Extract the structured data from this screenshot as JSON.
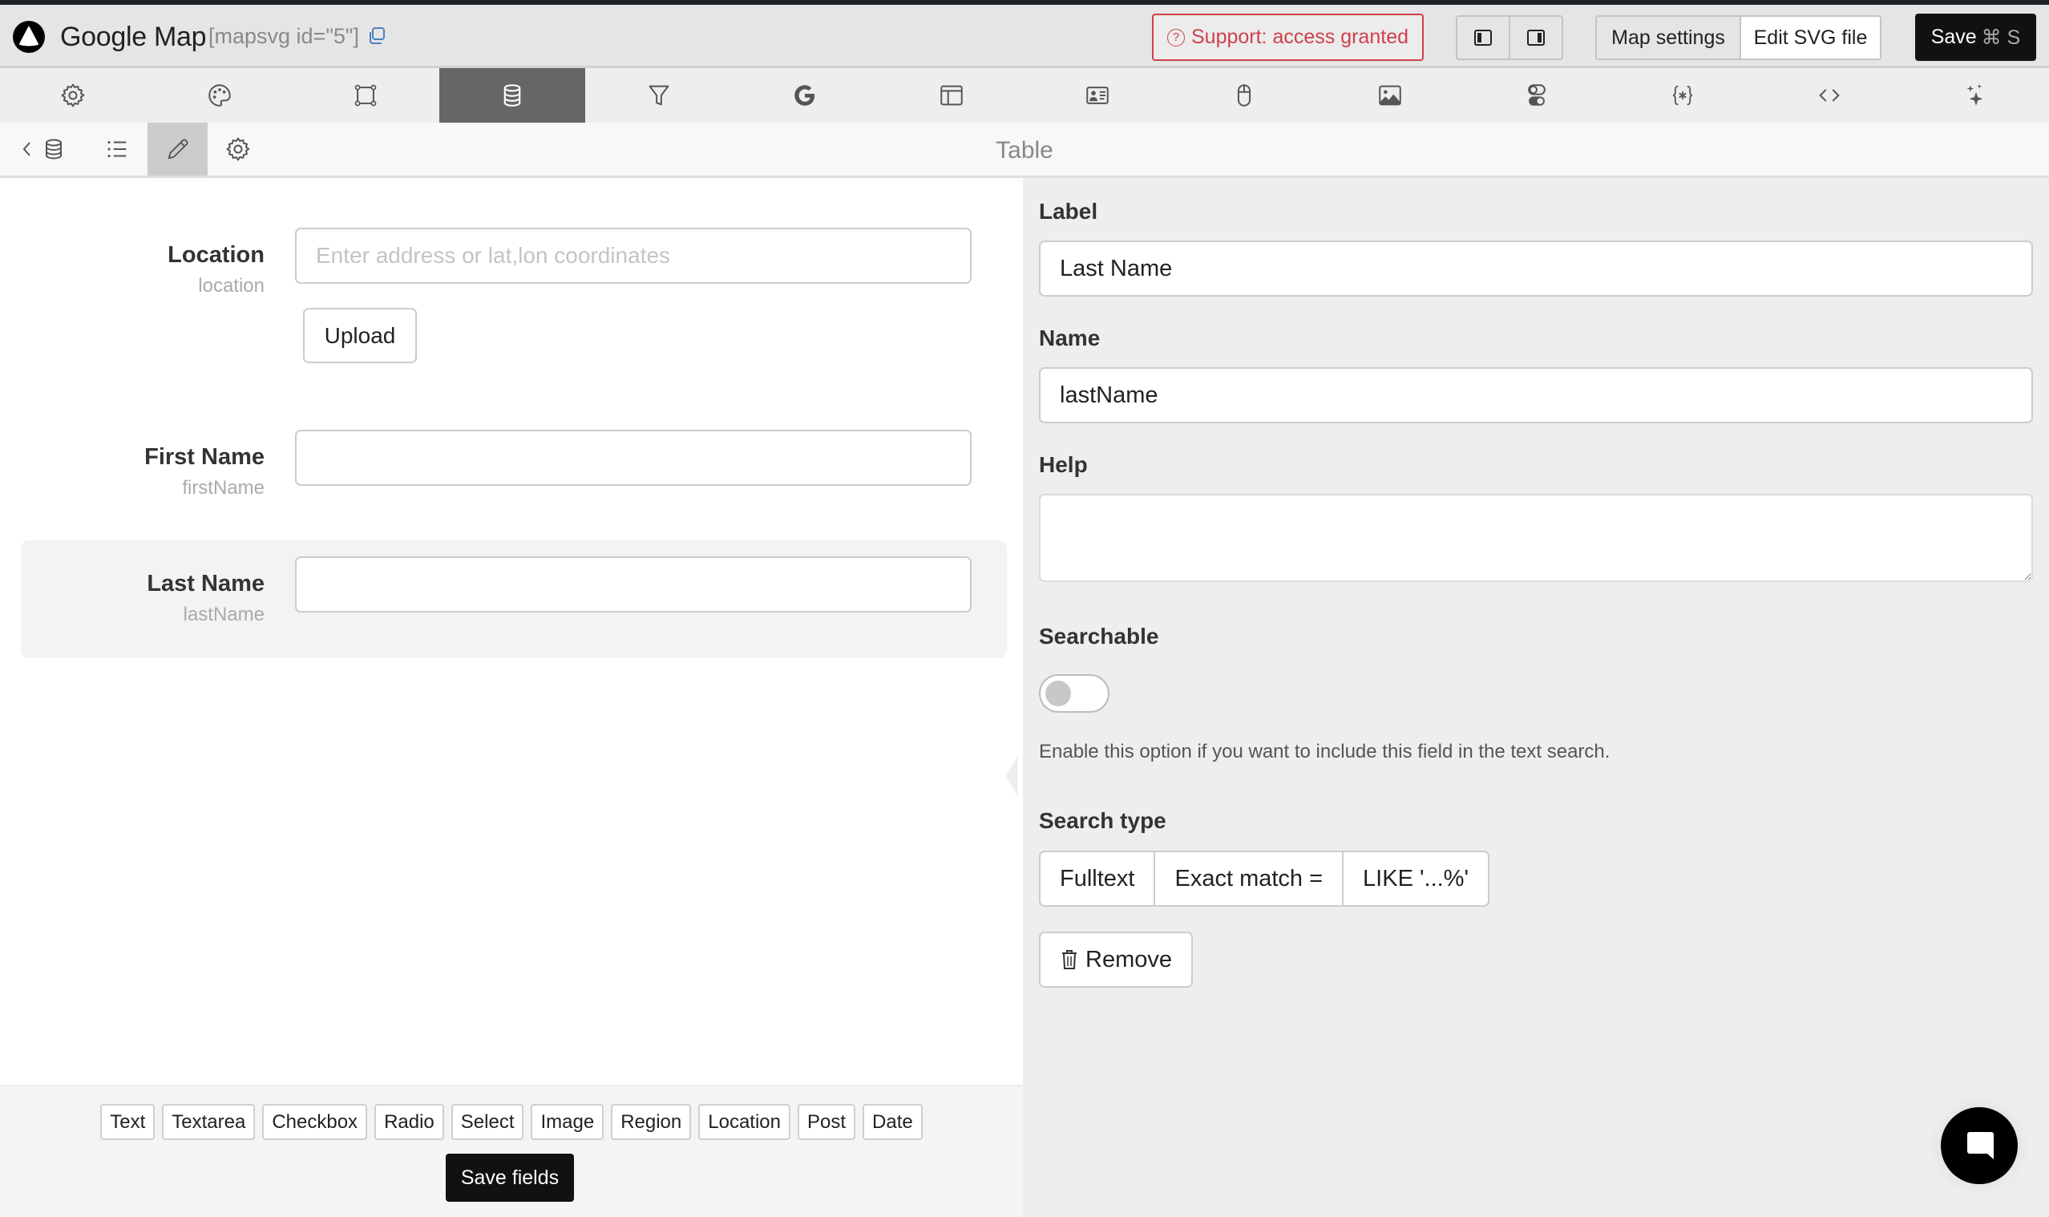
{
  "header": {
    "app_title": "Google Map",
    "shortcode": "[mapsvg id=\"5\"]",
    "support_label": "Support: access granted",
    "map_settings_label": "Map settings",
    "edit_svg_label": "Edit SVG file",
    "save_label": "Save",
    "save_shortcut": "⌘ S",
    "colors": {
      "support": "#d0404a",
      "save_bg": "#111111"
    }
  },
  "icon_toolbar": {
    "items": [
      {
        "icon": "gear-icon",
        "active": false
      },
      {
        "icon": "palette-icon",
        "active": false
      },
      {
        "icon": "vector-square-icon",
        "active": false
      },
      {
        "icon": "database-icon",
        "active": true
      },
      {
        "icon": "filter-icon",
        "active": false
      },
      {
        "icon": "google-icon",
        "active": false
      },
      {
        "icon": "layout-icon",
        "active": false
      },
      {
        "icon": "contact-card-icon",
        "active": false
      },
      {
        "icon": "mouse-icon",
        "active": false
      },
      {
        "icon": "image-icon",
        "active": false
      },
      {
        "icon": "toggles-icon",
        "active": false
      },
      {
        "icon": "variable-braces-icon",
        "active": false
      },
      {
        "icon": "code-icon",
        "active": false
      },
      {
        "icon": "sparkles-icon",
        "active": false
      }
    ]
  },
  "sub_toolbar": {
    "title": "Table",
    "items": [
      {
        "icon": "back-database-icon",
        "active": false
      },
      {
        "icon": "list-icon",
        "active": false
      },
      {
        "icon": "pencil-icon",
        "active": true
      },
      {
        "icon": "gear-icon",
        "active": false
      }
    ]
  },
  "form_fields": [
    {
      "label": "Location",
      "name": "location",
      "value": "",
      "placeholder": "Enter address or lat,lon coordinates",
      "upload_label": "Upload",
      "selected": false
    },
    {
      "label": "First Name",
      "name": "firstName",
      "value": "",
      "placeholder": "",
      "selected": false
    },
    {
      "label": "Last Name",
      "name": "lastName",
      "value": "",
      "placeholder": "",
      "selected": true
    }
  ],
  "field_types": [
    "Text",
    "Textarea",
    "Checkbox",
    "Radio",
    "Select",
    "Image",
    "Region",
    "Location",
    "Post",
    "Date"
  ],
  "save_fields_label": "Save fields",
  "field_editor": {
    "label_heading": "Label",
    "label_value": "Last Name",
    "name_heading": "Name",
    "name_value": "lastName",
    "help_heading": "Help",
    "help_value": "",
    "searchable_heading": "Searchable",
    "searchable_on": false,
    "searchable_help": "Enable this option if you want to include this field in the text search.",
    "search_type_heading": "Search type",
    "search_types": [
      "Fulltext",
      "Exact match =",
      "LIKE '...%'"
    ],
    "remove_label": "Remove"
  }
}
